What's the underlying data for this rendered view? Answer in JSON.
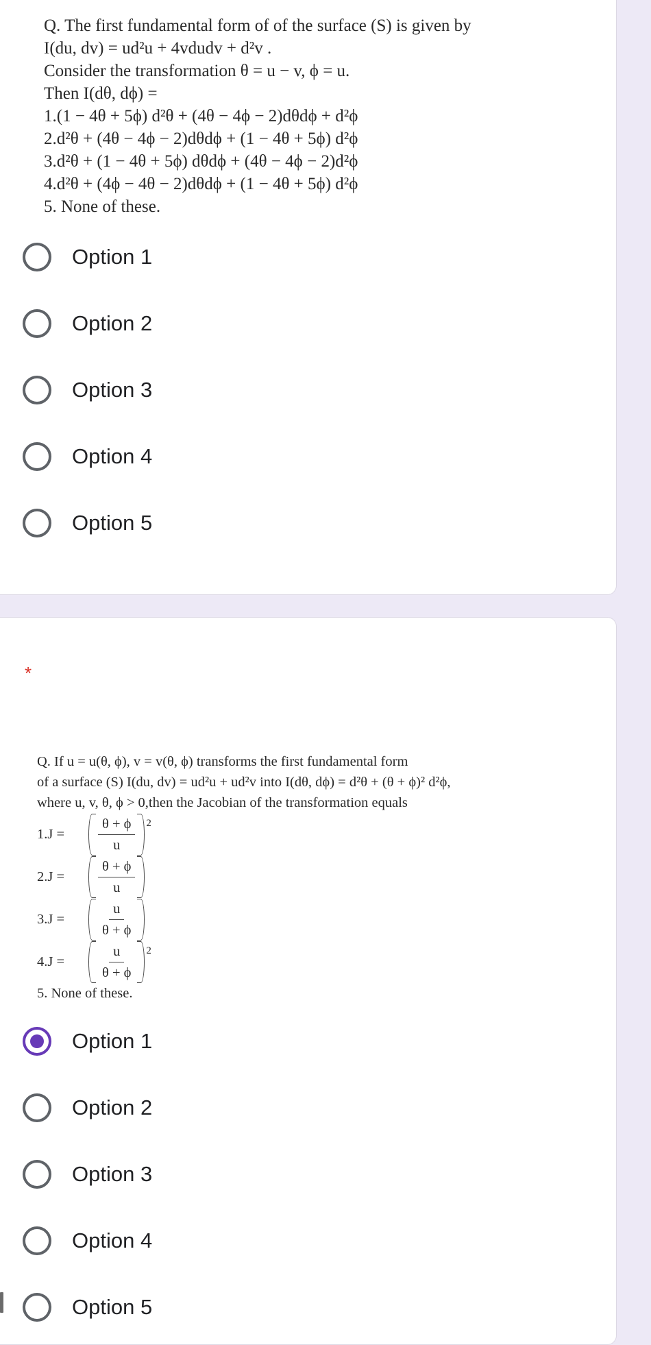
{
  "colors": {
    "background": "#ede9f6",
    "card": "#ffffff",
    "accent": "#673ab7",
    "radio_unchecked": "#5f6368",
    "required_star": "#d93025"
  },
  "question1": {
    "lines": [
      "Q. The first fundamental form of of the surface (S) is given by",
      "I(du, dv) = ud²u + 4vdudv + d²v .",
      "Consider the transformation θ = u − v, ϕ = u.",
      "Then I(dθ, dϕ) =",
      "1.(1 − 4θ + 5ϕ) d²θ + (4θ − 4ϕ − 2)dθdϕ + d²ϕ",
      "2.d²θ + (4θ − 4ϕ − 2)dθdϕ + (1 − 4θ + 5ϕ) d²ϕ",
      "3.d²θ + (1 − 4θ + 5ϕ) dθdϕ + (4θ − 4ϕ − 2)d²ϕ",
      "4.d²θ + (4ϕ − 4θ − 2)dθdϕ + (1 − 4θ + 5ϕ) d²ϕ",
      "5. None of these."
    ],
    "options": [
      {
        "label": "Option 1",
        "selected": false
      },
      {
        "label": "Option 2",
        "selected": false
      },
      {
        "label": "Option 3",
        "selected": false
      },
      {
        "label": "Option 4",
        "selected": false
      },
      {
        "label": "Option 5",
        "selected": false
      }
    ]
  },
  "question2": {
    "required_marker": "*",
    "lines": [
      "Q. If u = u(θ, ϕ), v = v(θ, ϕ) transforms the first fundamental form",
      "of a surface (S) I(du, dv) = ud²u + ud²v into  I(dθ, dϕ) = d²θ + (θ + ϕ)² d²ϕ,",
      "where u, v, θ, ϕ > 0,then the Jacobian of the transformation equals"
    ],
    "choices": [
      {
        "label": "1.J =",
        "numerator": "θ + ϕ",
        "denominator": "u",
        "power": "2"
      },
      {
        "label": "2.J =",
        "numerator": "θ + ϕ",
        "denominator": "u",
        "power": ""
      },
      {
        "label": "3.J =",
        "numerator": "u",
        "denominator": "θ + ϕ",
        "power": ""
      },
      {
        "label": "4.J =",
        "numerator": "u",
        "denominator": "θ + ϕ",
        "power": "2"
      }
    ],
    "none_line": "5. None of these.",
    "options": [
      {
        "label": "Option 1",
        "selected": true
      },
      {
        "label": "Option 2",
        "selected": false
      },
      {
        "label": "Option 3",
        "selected": false
      },
      {
        "label": "Option 4",
        "selected": false
      },
      {
        "label": "Option 5",
        "selected": false
      }
    ]
  }
}
